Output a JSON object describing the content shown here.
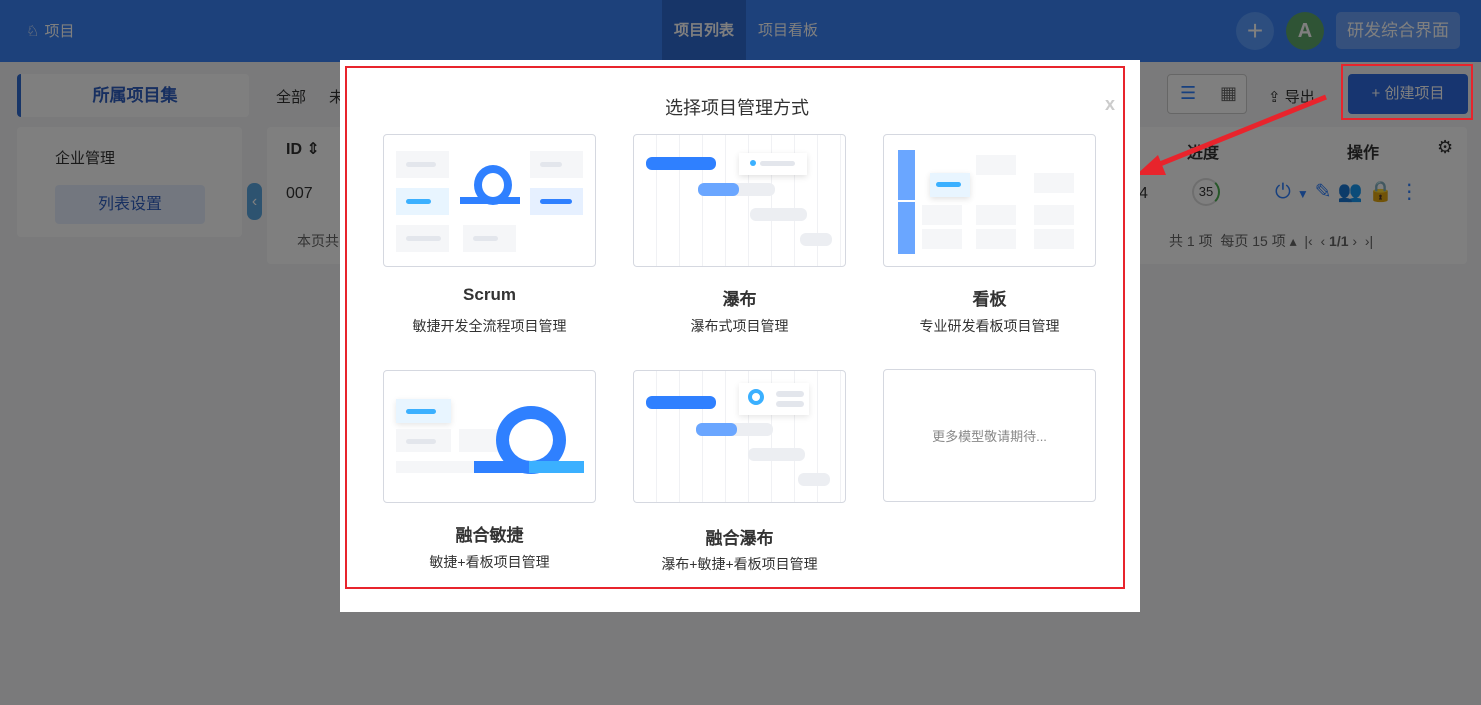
{
  "header": {
    "logo_icon": "rocket-icon",
    "title": "项目",
    "tabs": [
      {
        "label": "项目列表",
        "active": true
      },
      {
        "label": "项目看板",
        "active": false
      }
    ],
    "avatar": "A",
    "workspace": "研发综合界面",
    "add_icon": "plus-icon"
  },
  "sidebar": {
    "project_set": "所属项目集",
    "item": "企业管理",
    "list_settings": "列表设置"
  },
  "filters": {
    "all": "全部",
    "next": "未"
  },
  "toolbar": {
    "export": "导出",
    "create": "+ 创建项目"
  },
  "table": {
    "col_id": "ID",
    "col_progress": "进度",
    "col_actions": "操作",
    "row": {
      "id": "007",
      "partial": "4",
      "progress": "35"
    },
    "footer_left": "本页共",
    "total": "共 1 项",
    "per_page": "每页 15 项",
    "page": "1/1"
  },
  "modal": {
    "title": "选择项目管理方式",
    "close": "x",
    "options": [
      {
        "title": "Scrum",
        "subtitle": "敏捷开发全流程项目管理"
      },
      {
        "title": "瀑布",
        "subtitle": "瀑布式项目管理"
      },
      {
        "title": "看板",
        "subtitle": "专业研发看板项目管理"
      },
      {
        "title": "融合敏捷",
        "subtitle": "敏捷+看板项目管理"
      },
      {
        "title": "融合瀑布",
        "subtitle": "瀑布+敏捷+看板项目管理"
      }
    ],
    "more": "更多模型敬请期待..."
  },
  "colors": {
    "header": "#3a82f6",
    "accent": "#2f80ff",
    "highlight": "#e8242c"
  }
}
